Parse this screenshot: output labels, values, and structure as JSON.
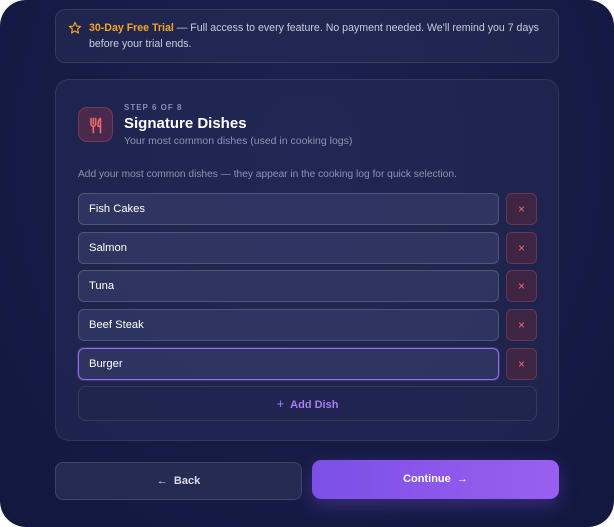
{
  "banner": {
    "highlight": "30-Day Free Trial",
    "message": " — Full access to every feature. No payment needed. We'll remind you 7 days before your trial ends.",
    "icon": "star-icon"
  },
  "step": {
    "label": "STEP 6 OF 8",
    "title": "Signature Dishes",
    "subtitle": "Your most common dishes (used in cooking logs)",
    "icon": "utensils-icon"
  },
  "hint": "Add your most common dishes — they appear in the cooking log for quick selection.",
  "dishes": [
    {
      "value": "Fish Cakes"
    },
    {
      "value": "Salmon"
    },
    {
      "value": "Tuna"
    },
    {
      "value": "Beef Steak"
    },
    {
      "value": "Burger"
    }
  ],
  "remove_icon": "×",
  "add_dish_label": "Add Dish",
  "nav": {
    "back_label": "Back",
    "continue_label": "Continue"
  },
  "colors": {
    "accent": "#9b6cf0",
    "highlight": "#f5a524",
    "danger": "#ef6a6f"
  }
}
